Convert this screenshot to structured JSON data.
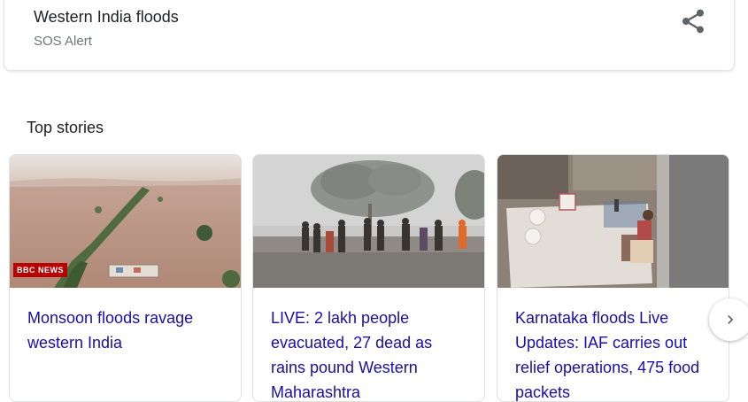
{
  "sos_alert": {
    "title": "Western India floods",
    "subtitle": "SOS Alert",
    "share_icon": "share-icon"
  },
  "top_stories": {
    "heading": "Top stories",
    "stories": [
      {
        "headline": "Monsoon floods ravage western India",
        "image": "aerial-flood-image",
        "logo_text": "BBC NEWS"
      },
      {
        "headline": "LIVE: 2 lakh people evacuated, 27 dead as rains pound Western Maharashtra",
        "image": "people-wading-flood-image"
      },
      {
        "headline": "Karnataka floods Live Updates: IAF carries out relief operations, 475 food packets",
        "image": "rooftop-relief-image"
      }
    ],
    "next_icon": "chevron-right-icon"
  },
  "colors": {
    "link": "#1a0dab",
    "text": "#202124",
    "secondary_text": "#70757a",
    "border": "#dfe1e5"
  }
}
